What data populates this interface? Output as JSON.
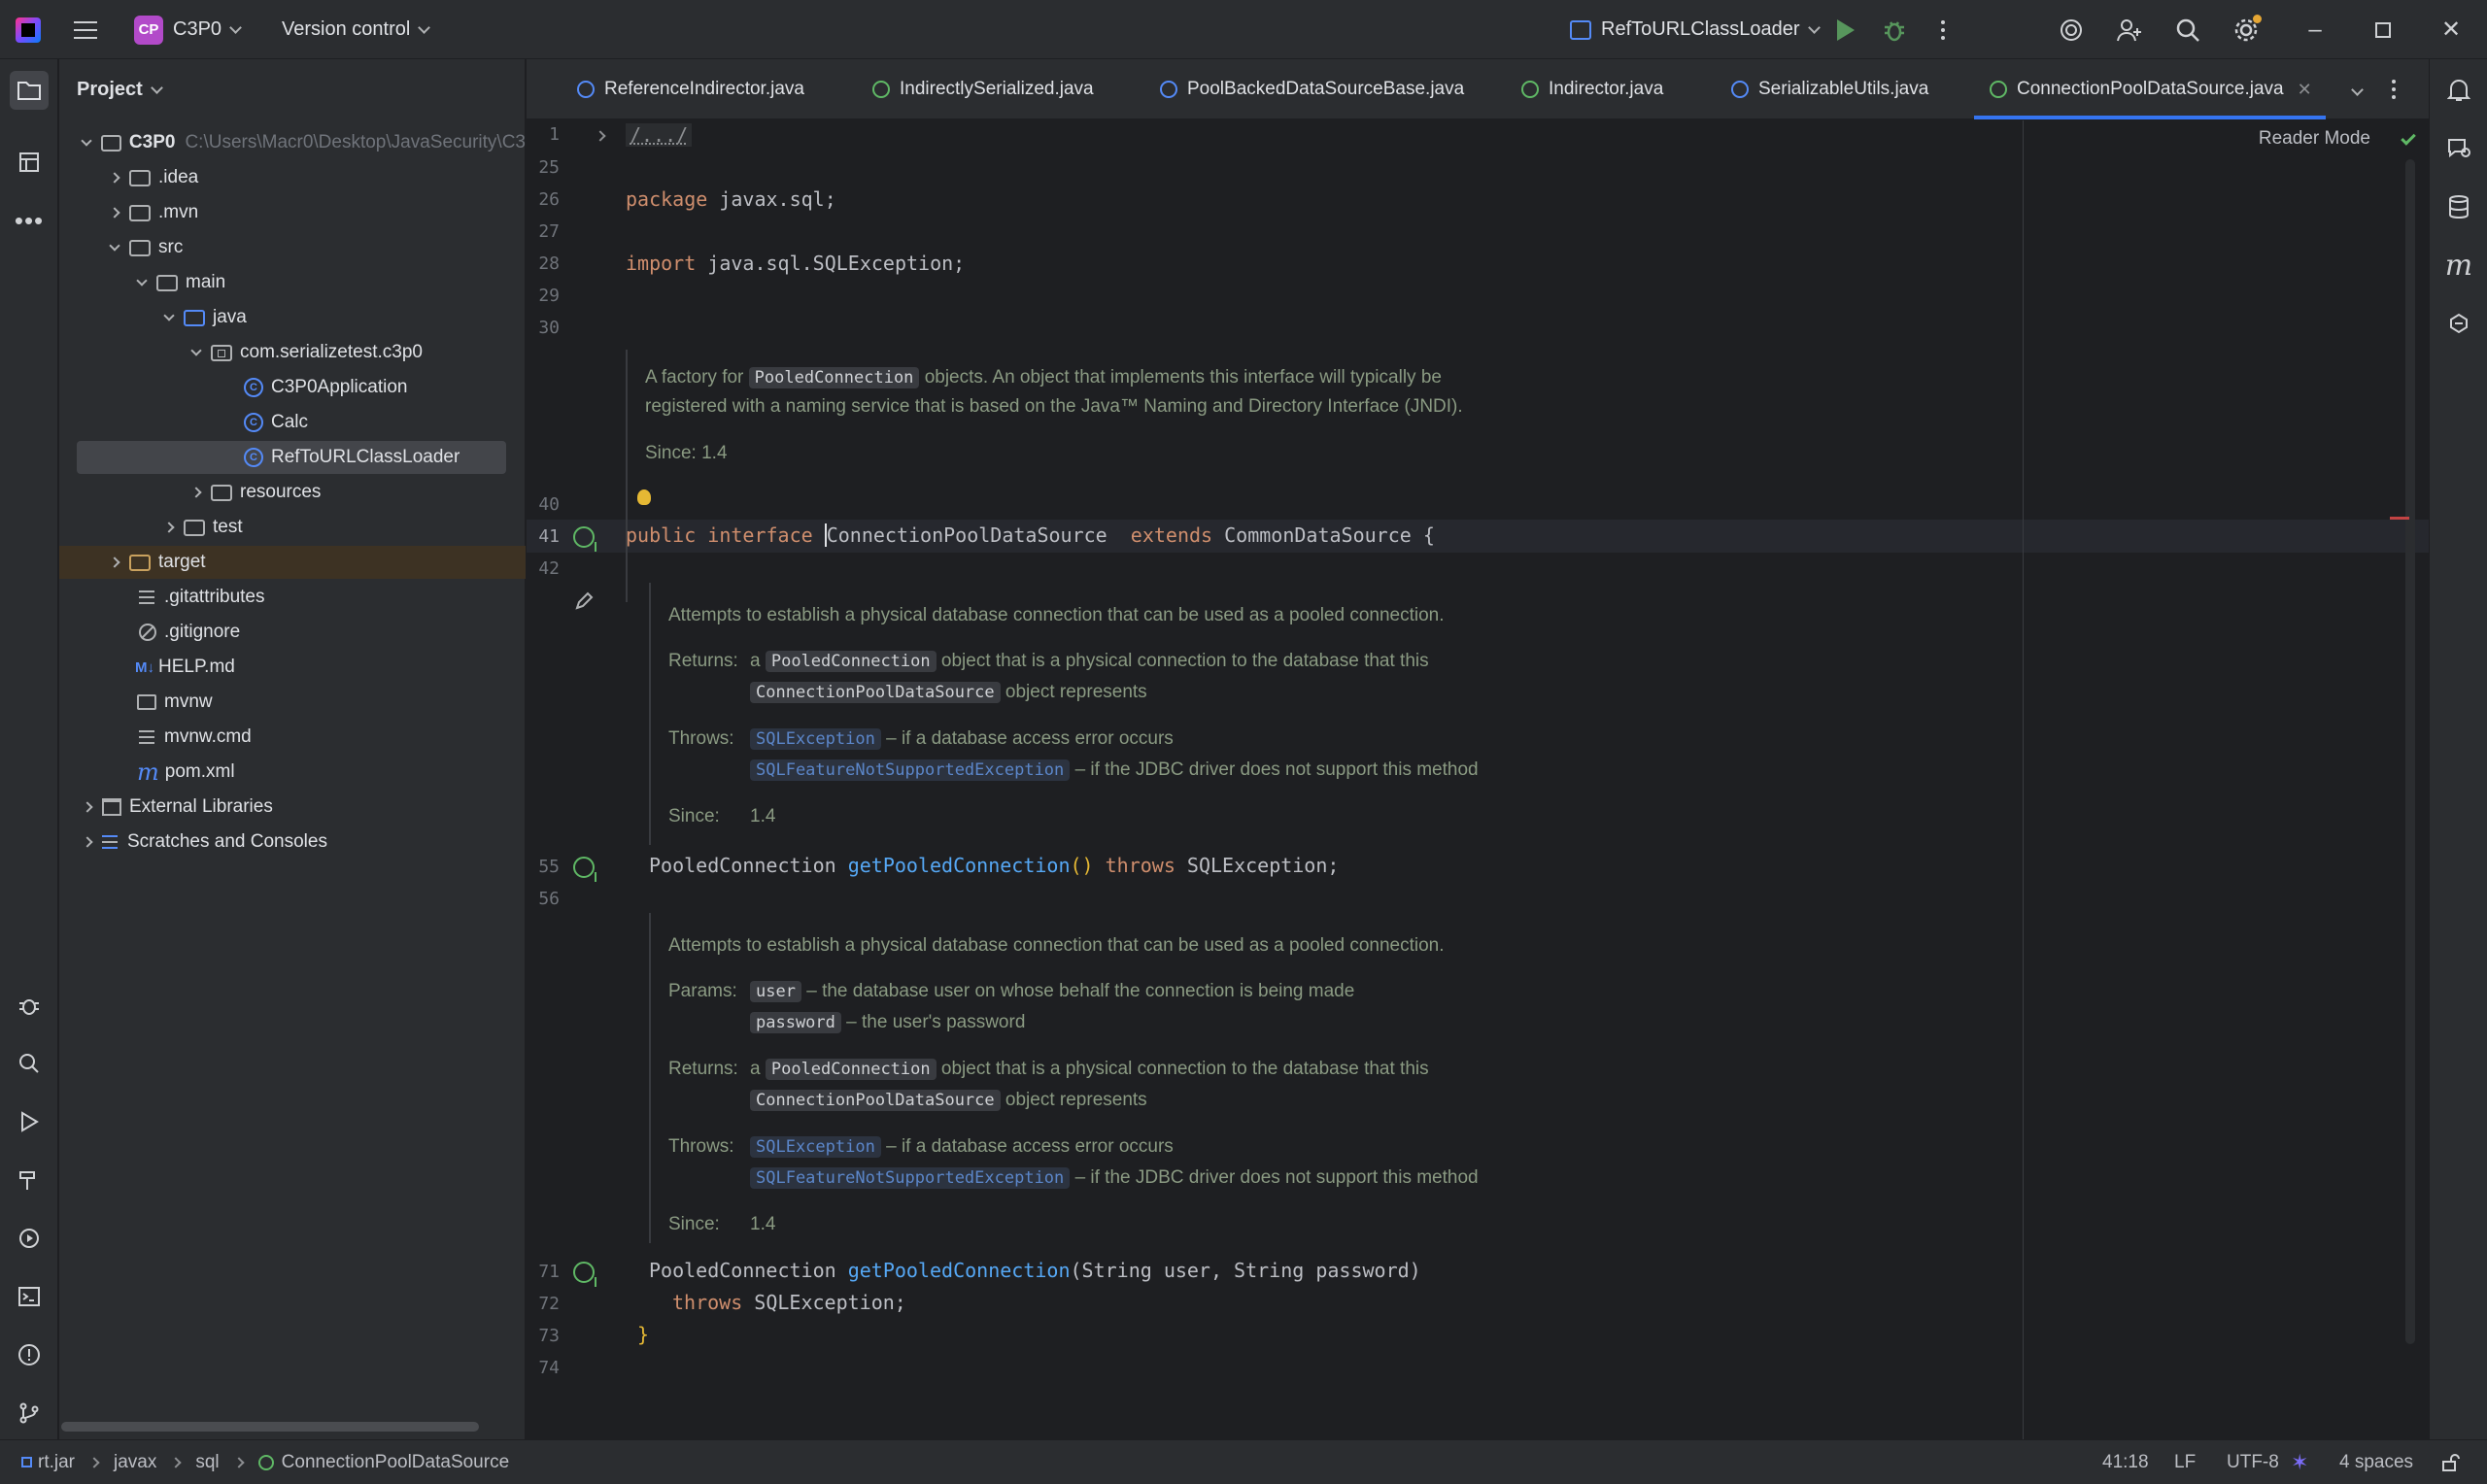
{
  "titlebar": {
    "project_badge": "CP",
    "project_name": "C3P0",
    "vcs_label": "Version control",
    "run_config": "RefToURLClassLoader"
  },
  "project_panel": {
    "title": "Project",
    "tree": [
      {
        "label": "C3P0",
        "extra": "C:\\Users\\Macr0\\Desktop\\JavaSecurity\\C3"
      },
      {
        "label": ".idea"
      },
      {
        "label": ".mvn"
      },
      {
        "label": "src"
      },
      {
        "label": "main"
      },
      {
        "label": "java"
      },
      {
        "label": "com.serializetest.c3p0"
      },
      {
        "label": "C3P0Application"
      },
      {
        "label": "Calc"
      },
      {
        "label": "RefToURLClassLoader"
      },
      {
        "label": "resources"
      },
      {
        "label": "test"
      },
      {
        "label": "target"
      },
      {
        "label": ".gitattributes"
      },
      {
        "label": ".gitignore"
      },
      {
        "label": "HELP.md"
      },
      {
        "label": "mvnw"
      },
      {
        "label": "mvnw.cmd"
      },
      {
        "label": "pom.xml"
      },
      {
        "label": "External Libraries"
      },
      {
        "label": "Scratches and Consoles"
      }
    ]
  },
  "tabs": [
    {
      "label": "ReferenceIndirector.java"
    },
    {
      "label": "IndirectlySerialized.java"
    },
    {
      "label": "PoolBackedDataSourceBase.java"
    },
    {
      "label": "Indirector.java"
    },
    {
      "label": "SerializableUtils.java"
    },
    {
      "label": "ConnectionPoolDataSource.java"
    }
  ],
  "editor": {
    "reader_mode": "Reader Mode",
    "line_numbers": [
      "1",
      "25",
      "26",
      "27",
      "28",
      "29",
      "30",
      "40",
      "41",
      "42",
      "55",
      "56",
      "71",
      "72",
      "73",
      "74"
    ],
    "code": {
      "l1": "/.../",
      "l26_kw": "package",
      "l26_rest": " javax.sql;",
      "l28_kw": "import",
      "l28_rest": " java.sql.SQLException;",
      "l41_kw": "public interface",
      "l41_name": "ConnectionPoolDataSource",
      "l41_kw2": "extends",
      "l41_rest": " CommonDataSource {",
      "l55_type": "PooledConnection ",
      "l55_fn": "getPooledConnection",
      "l55_paren": "() ",
      "l55_kw": "throws",
      "l55_rest": " SQLException;",
      "l71_type": "PooledConnection ",
      "l71_fn": "getPooledConnection",
      "l71_rest": "(String user, String password)",
      "l72_kw": "throws",
      "l72_rest": " SQLException;",
      "l73": "}"
    },
    "doc1": {
      "a": "A factory for",
      "chip": "PooledConnection",
      "b": "objects. An object that implements this interface will typically be",
      "c": "registered with a naming service that is based on the Java™ Naming and Directory Interface (JNDI).",
      "since_label": "Since:",
      "since": "1.4"
    },
    "doc2": {
      "summary": "Attempts to establish a physical database connection that can be used as a pooled connection.",
      "returns_label": "Returns:",
      "returns_a": "a",
      "returns_chip": "PooledConnection",
      "returns_b": "object that is a physical connection to the database that this",
      "returns_chip2": "ConnectionPoolDataSource",
      "returns_c": "object represents",
      "throws_label": "Throws:",
      "throws1_chip": "SQLException",
      "throws1_text": "– if a database access error occurs",
      "throws2_chip": "SQLFeatureNotSupportedException",
      "throws2_text": "– if the JDBC driver does not support this method",
      "since_label": "Since:",
      "since": "1.4"
    },
    "doc3": {
      "summary": "Attempts to establish a physical database connection that can be used as a pooled connection.",
      "params_label": "Params:",
      "p1_chip": "user",
      "p1_text": "– the database user on whose behalf the connection is being made",
      "p2_chip": "password",
      "p2_text": "– the user's password",
      "returns_label": "Returns:",
      "returns_a": "a",
      "returns_chip": "PooledConnection",
      "returns_b": "object that is a physical connection to the database that this",
      "returns_chip2": "ConnectionPoolDataSource",
      "returns_c": "object represents",
      "throws_label": "Throws:",
      "throws1_chip": "SQLException",
      "throws1_text": "– if a database access error occurs",
      "throws2_chip": "SQLFeatureNotSupportedException",
      "throws2_text": "– if the JDBC driver does not support this method",
      "since_label": "Since:",
      "since": "1.4"
    }
  },
  "statusbar": {
    "breadcrumbs": [
      "rt.jar",
      "javax",
      "sql",
      "ConnectionPoolDataSource"
    ],
    "position": "41:18",
    "line_ending": "LF",
    "encoding": "UTF-8",
    "indent": "4 spaces"
  },
  "colors": {
    "accent": "#3574f0",
    "keyword": "#cf8e6d",
    "function": "#56a8f5",
    "run_green": "#57965c"
  }
}
